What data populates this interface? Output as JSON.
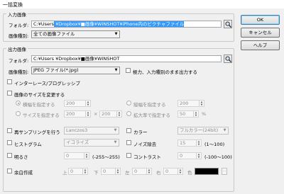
{
  "window": {
    "title": "一括変換"
  },
  "input_group": {
    "title": "入力画像",
    "folder_label": "フォルダ:",
    "folder_prefix": "C:¥Users",
    "folder_selected": "¥Dropbox¥■画像¥WINSHOT¥iPhone内のピクチャファイル",
    "type_label": "画像種別:",
    "type_value": "全ての画像ファイル"
  },
  "output_group": {
    "title": "出力画像",
    "folder_label": "フォルダ:",
    "folder_value": "C:¥Users      ¥Dropbox¥■画像¥WINSHOT",
    "type_label": "画像種別:",
    "type_value": "JPEG ファイル(*.jpg)",
    "compress_label": "極力、入力種別のまま出力する",
    "interlace_label": "インターレース/プログレッシブ"
  },
  "resize": {
    "label": "画像のサイズを変更する",
    "width_label": "横幅を指定する",
    "width_value": "200",
    "height_label": "縦幅を指定する",
    "height_value": "200",
    "size_label": "サイズを指定する",
    "size_w": "200",
    "size_x": "×",
    "size_h": "200",
    "scale_label": "拡大率で指定する",
    "scale_value": "50",
    "scale_unit": "%"
  },
  "adjust": {
    "resample_label": "再サンプリングを行う",
    "resample_value": "Lanczos3",
    "color_label": "カラー",
    "color_value": "フルカラー(24bit)",
    "histogram_label": "ヒストグラム",
    "histogram_value": "イコライズ",
    "noise_label": "ノイズ除去",
    "noise_value": "15",
    "noise_range": "(1〜100)",
    "brightness_label": "明るさ",
    "brightness_value": "0",
    "brightness_range": "(-255〜255)",
    "contrast_label": "コントラスト",
    "contrast_value": "0",
    "contrast_range": "(-100〜100)",
    "margin_label": "余白作成",
    "top_label": "上",
    "top_value": "0",
    "bottom_label": "下",
    "bottom_value": "0",
    "left_label": "左",
    "left_value": "0",
    "right_label": "右",
    "right_value": "0",
    "color_pick_label": "色",
    "color_swatch": "#000000",
    "more_label": "..."
  },
  "buttons": {
    "ok": "OK",
    "cancel": "キャンセル",
    "help": "ヘルプ"
  }
}
